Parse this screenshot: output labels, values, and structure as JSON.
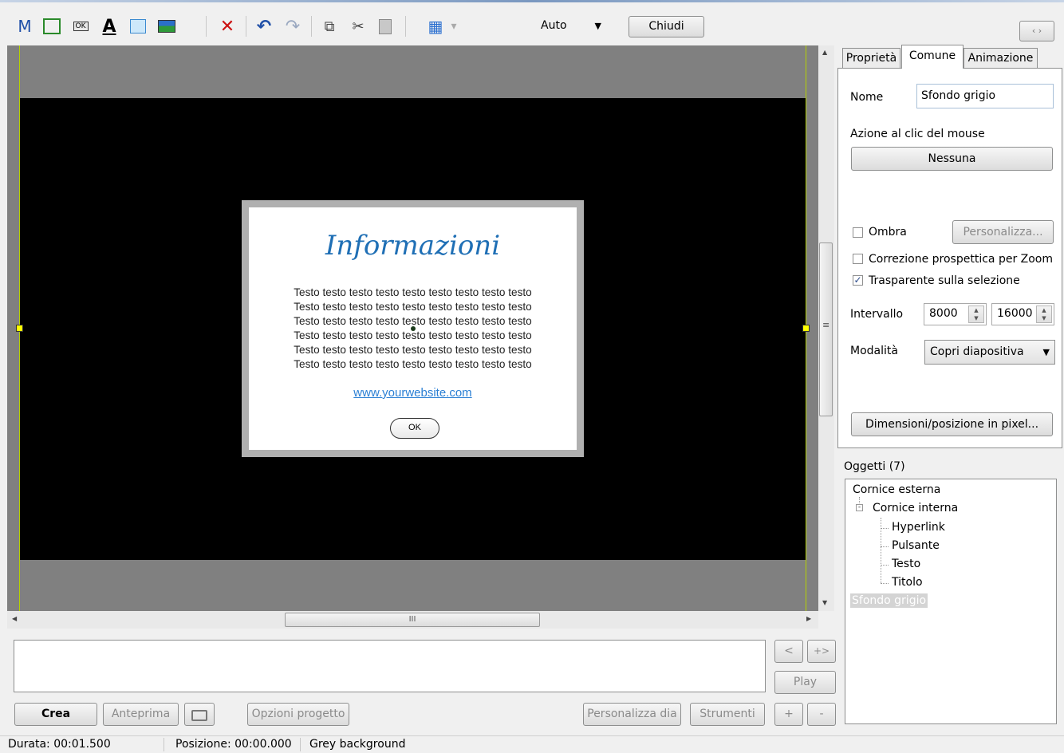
{
  "toolbar": {
    "icons": [
      {
        "name": "m-icon",
        "glyph": "M",
        "color": "#1e4fa8"
      },
      {
        "name": "frame-icon",
        "glyph": "□",
        "color": "#2a8a2a"
      },
      {
        "name": "ok-button-icon",
        "glyph": "OK",
        "color": "#333333"
      },
      {
        "name": "text-icon",
        "glyph": "A",
        "color": "#111111"
      },
      {
        "name": "rectangle-icon",
        "glyph": "■",
        "color": "#9bd0f2"
      },
      {
        "name": "image-icon",
        "glyph": "▨",
        "color": "#1a6f2e"
      },
      {
        "name": "delete-icon",
        "glyph": "✕",
        "color": "#cc1111"
      },
      {
        "name": "undo-icon",
        "glyph": "↶",
        "color": "#2251a8"
      },
      {
        "name": "redo-icon",
        "glyph": "↷",
        "color": "#9aa8c0"
      },
      {
        "name": "copy-icon",
        "glyph": "⧉",
        "color": "#555555"
      },
      {
        "name": "cut-icon",
        "glyph": "✂",
        "color": "#444444"
      },
      {
        "name": "paste-icon",
        "glyph": "📋",
        "color": "#888888"
      },
      {
        "name": "grid-icon",
        "glyph": "▦",
        "color": "#2a6fd0"
      },
      {
        "name": "grid-dropdown-icon",
        "glyph": "▾",
        "color": "#aaaaaa"
      }
    ],
    "zoom_value": "Auto",
    "close_label": "Chiudi",
    "nav_label": "‹ ›"
  },
  "canvas": {
    "dialog": {
      "title": "Informazioni",
      "text_lines": [
        "Testo testo testo testo testo testo testo testo testo",
        "Testo testo testo testo testo testo testo testo testo",
        "Testo testo testo testo testo testo testo testo testo",
        "Testo testo testo testo testo testo testo testo testo",
        "Testo testo testo testo testo testo testo testo testo",
        "Testo testo testo testo testo testo testo testo testo"
      ],
      "link": "www.yourwebsite.com",
      "ok": "OK"
    },
    "hscroll_grip": "III",
    "vscroll_grip": "≡"
  },
  "tabs": {
    "proprieta": "Proprietà",
    "comune": "Comune",
    "animazione": "Animazione"
  },
  "props": {
    "name_label": "Nome",
    "name_value": "Sfondo grigio",
    "click_label": "Azione al clic del mouse",
    "click_value": "Nessuna",
    "shadow_label": "Ombra",
    "customize_label": "Personalizza...",
    "perspective_label": "Correzione prospettica per Zoom",
    "transparent_label": "Trasparente sulla selezione",
    "interval_label": "Intervallo",
    "interval_start": "8000",
    "interval_end": "16000",
    "mode_label": "Modalità",
    "mode_value": "Copri diapositiva",
    "size_button": "Dimensioni/posizione in pixel..."
  },
  "objects": {
    "header": "Oggetti (7)",
    "items": [
      "Cornice esterna",
      "Cornice interna",
      "Hyperlink",
      "Pulsante",
      "Testo",
      "Titolo",
      "Sfondo grigio"
    ]
  },
  "timeline": {
    "prev": "<",
    "next_add": "+>",
    "play": "Play",
    "plus": "+",
    "minus": "-"
  },
  "bottom": {
    "crea": "Crea",
    "anteprima": "Anteprima",
    "opzioni": "Opzioni progetto",
    "personalizza": "Personalizza dia",
    "strumenti": "Strumenti"
  },
  "status": {
    "durata": "Durata: 00:01.500",
    "posizione": "Posizione: 00:00.000",
    "info": "Grey background"
  }
}
